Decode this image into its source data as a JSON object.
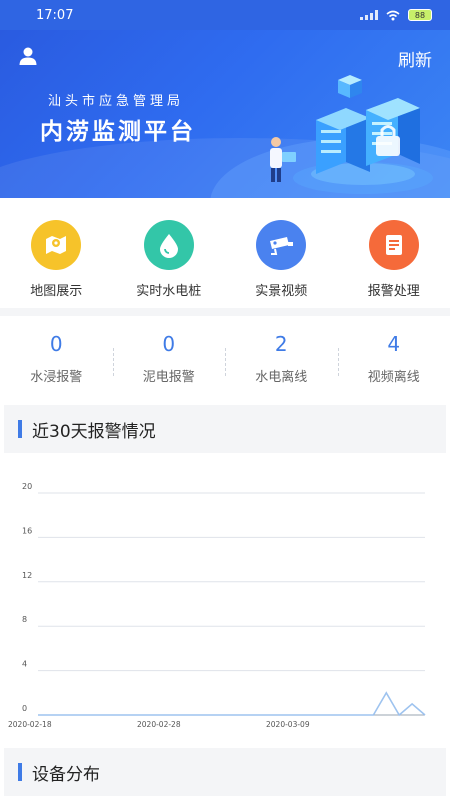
{
  "status_bar": {
    "time": "17:07",
    "battery": "88"
  },
  "header": {
    "refresh_label": "刷新",
    "org_name": "汕头市应急管理局",
    "platform_title": "内涝监测平台"
  },
  "quick_actions": [
    {
      "label": "地图展示",
      "icon": "map-icon",
      "color": "#f6c32a"
    },
    {
      "label": "实时水电桩",
      "icon": "water-drop-icon",
      "color": "#33c6a8"
    },
    {
      "label": "实景视频",
      "icon": "camera-icon",
      "color": "#4a82ef"
    },
    {
      "label": "报警处理",
      "icon": "alarm-doc-icon",
      "color": "#f56a3a"
    }
  ],
  "stats": [
    {
      "value": "0",
      "label": "水浸报警"
    },
    {
      "value": "0",
      "label": "泥电报警"
    },
    {
      "value": "2",
      "label": "水电离线"
    },
    {
      "value": "4",
      "label": "视频离线"
    }
  ],
  "alarm_section": {
    "title": "近30天报警情况"
  },
  "device_section": {
    "title": "设备分布"
  },
  "colors": {
    "accent": "#3f7be6",
    "line": "#9ec3ef",
    "grid": "#dfe3ea"
  },
  "chart_data": {
    "type": "line",
    "y_ticks": [
      "20",
      "16",
      "12",
      "8",
      "4",
      "0"
    ],
    "ylim": [
      0,
      20
    ],
    "x_ticks": [
      {
        "label": "2020-02-18",
        "day": 0
      },
      {
        "label": "2020-02-28",
        "day": 10
      },
      {
        "label": "2020-03-09",
        "day": 20
      }
    ],
    "x_days": 30,
    "points": [
      {
        "day": 0,
        "value": 0
      },
      {
        "day": 26,
        "value": 0
      },
      {
        "day": 27,
        "value": 2
      },
      {
        "day": 28,
        "value": 0
      },
      {
        "day": 29,
        "value": 1
      },
      {
        "day": 30,
        "value": 0
      }
    ]
  }
}
